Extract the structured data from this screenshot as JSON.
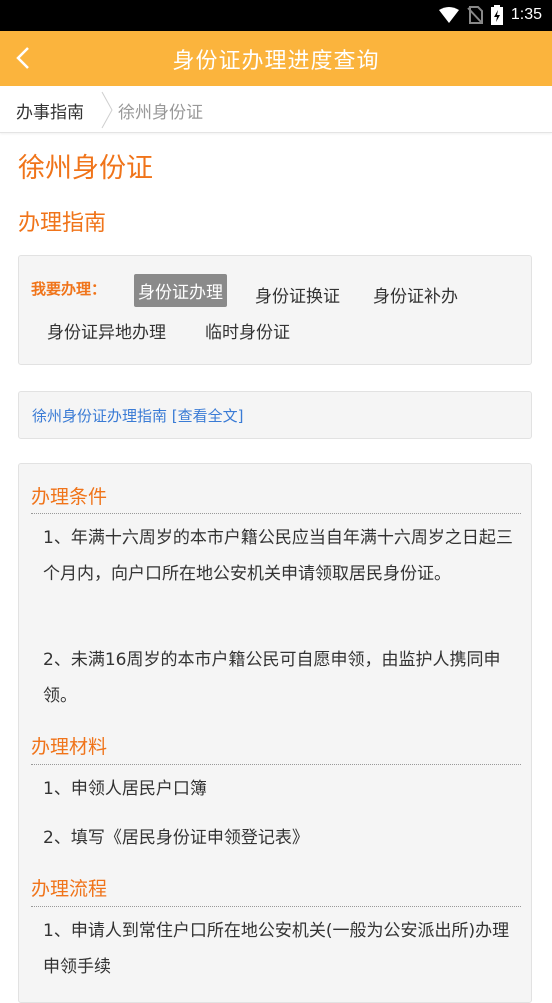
{
  "status": {
    "time": "1:35"
  },
  "appbar": {
    "title": "身份证办理进度查询"
  },
  "breadcrumb": {
    "home": "办事指南",
    "current": "徐州身份证"
  },
  "page": {
    "city_title": "徐州身份证",
    "guide_title": "办理指南"
  },
  "want": {
    "label": "我要办理：",
    "options": [
      "身份证办理",
      "身份证换证",
      "身份证补办",
      "身份证异地办理",
      "临时身份证"
    ],
    "selected": "身份证办理"
  },
  "guide_link": "徐州身份证办理指南 [查看全文]",
  "sections": {
    "conditions": {
      "title": "办理条件",
      "items": [
        "1、年满十六周岁的本市户籍公民应当自年满十六周岁之日起三个月内，向户口所在地公安机关申请领取居民身份证。",
        "2、未满16周岁的本市户籍公民可自愿申领，由监护人携同申领。"
      ]
    },
    "materials": {
      "title": "办理材料",
      "items": [
        "1、申领人居民户口簿",
        "2、填写《居民身份证申领登记表》"
      ]
    },
    "process": {
      "title": "办理流程",
      "items": [
        "1、申请人到常住户口所在地公安机关(一般为公安派出所)办理申领手续"
      ]
    }
  }
}
